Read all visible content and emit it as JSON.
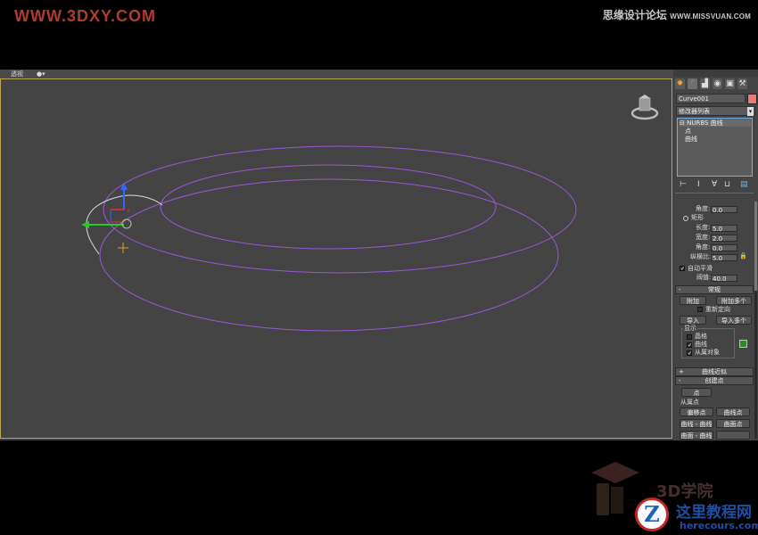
{
  "watermarks": {
    "top_left": "WWW.3DXY.COM",
    "top_right_cn": "思缘设计论坛",
    "top_right_url": "WWW.MISSVUAN.COM",
    "bottom_3d": "3D学院",
    "bottom_cn": "这里教程网",
    "bottom_url": "herecours.com",
    "bottom_logo_letter": "Z"
  },
  "viewport": {
    "label": "透视",
    "view_dropdown": "▾"
  },
  "colors": {
    "curve": "#9b59d6",
    "selected_curve": "#dcdcdc",
    "frame": "#bfa556",
    "gizmo_x": "#d33",
    "gizmo_y": "#2c2",
    "gizmo_z": "#36f"
  },
  "command_panel": {
    "tabs": [
      "create-icon",
      "modify-icon",
      "hierarchy-icon",
      "motion-icon",
      "display-icon",
      "utilities-icon"
    ],
    "object_name": "Curve001",
    "modifier_list": "修改器列表",
    "stack": {
      "root": "NURBS 曲线",
      "children": [
        "点",
        "曲线"
      ]
    },
    "approx": {
      "angle_label": "角度:",
      "angle_value": "0.0",
      "mode_label": "矩形",
      "length_label": "长度:",
      "length_value": "5.0",
      "width_label": "宽度:",
      "width_value": "2.0",
      "angle2_label": "角度:",
      "angle2_value": "0.0",
      "aspect_label": "纵横比:",
      "aspect_value": "5.0",
      "auto_smooth_label": "自动平滑",
      "threshold_label": "阈值:",
      "threshold_value": "40.0"
    },
    "general": {
      "title": "常规",
      "attach": "附加",
      "attach_multiple": "附加多个",
      "reorient": "重新定向",
      "import": "导入",
      "import_multiple": "导入多个",
      "display_label": "显示",
      "lattices": "晶格",
      "curves": "曲线",
      "dependents": "从属对象"
    },
    "curve_approx_title": "曲线近似",
    "create_points": {
      "title": "创建点",
      "point": "点",
      "dependent_points_label": "从属点",
      "offset_point": "偏移点",
      "curve_point": "曲线点",
      "curve_curve": "曲线 - 曲线",
      "surf_point": "曲面点",
      "surf_curve": "曲面 - 曲线"
    }
  }
}
